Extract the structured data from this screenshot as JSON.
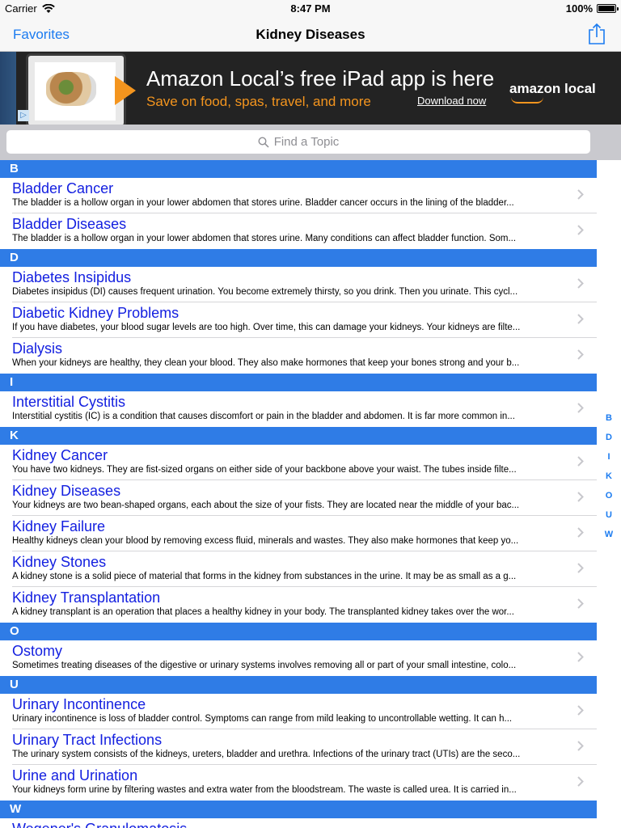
{
  "status": {
    "carrier": "Carrier",
    "time": "8:47 PM",
    "battery": "100%"
  },
  "nav": {
    "back_label": "Favorites",
    "title": "Kidney Diseases"
  },
  "ad": {
    "headline": "Amazon Local’s free iPad app is here",
    "subline": "Save on food, spas, travel, and more",
    "cta": "Download now",
    "logo": "amazon local"
  },
  "search": {
    "placeholder": "Find a Topic"
  },
  "sections": [
    {
      "letter": "B",
      "items": [
        {
          "title": "Bladder Cancer",
          "desc": "The bladder is a hollow organ in your lower abdomen that stores urine. Bladder cancer occurs in the lining of the bladder..."
        },
        {
          "title": "Bladder Diseases",
          "desc": "The bladder is a hollow organ in your lower abdomen that stores urine. Many conditions can affect bladder function. Som..."
        }
      ]
    },
    {
      "letter": "D",
      "items": [
        {
          "title": "Diabetes Insipidus",
          "desc": "Diabetes insipidus (DI) causes frequent urination. You become extremely thirsty, so you drink. Then you urinate. This cycl..."
        },
        {
          "title": "Diabetic Kidney Problems",
          "desc": "If you have diabetes, your blood sugar levels are too high. Over time, this can damage your kidneys. Your kidneys are filte..."
        },
        {
          "title": "Dialysis",
          "desc": "When your kidneys are healthy, they clean your blood. They also make hormones that keep your bones strong and your b..."
        }
      ]
    },
    {
      "letter": "I",
      "items": [
        {
          "title": "Interstitial Cystitis",
          "desc": "Interstitial cystitis (IC) is a condition that causes discomfort or pain in the bladder and abdomen. It is far more common in..."
        }
      ]
    },
    {
      "letter": "K",
      "items": [
        {
          "title": "Kidney Cancer",
          "desc": "You have two kidneys. They are fist-sized organs on either side of your backbone above your waist. The tubes inside filte..."
        },
        {
          "title": "Kidney Diseases",
          "desc": "Your kidneys are two bean-shaped organs, each about the size of your fists. They are located near the middle of your bac..."
        },
        {
          "title": "Kidney Failure",
          "desc": "Healthy kidneys clean your blood by removing excess fluid, minerals and wastes. They also make hormones that keep yo..."
        },
        {
          "title": "Kidney Stones",
          "desc": "A kidney stone is a solid piece of material that forms in the kidney from substances in the urine. It may be as small as a g..."
        },
        {
          "title": "Kidney Transplantation",
          "desc": "A kidney transplant is an operation that places a healthy kidney in your body. The transplanted kidney takes over the wor..."
        }
      ]
    },
    {
      "letter": "O",
      "items": [
        {
          "title": "Ostomy",
          "desc": "Sometimes treating diseases of the digestive or urinary systems involves removing all or part of your small intestine, colo..."
        }
      ]
    },
    {
      "letter": "U",
      "items": [
        {
          "title": "Urinary Incontinence",
          "desc": "Urinary incontinence is loss of bladder control. Symptoms can range from mild leaking to uncontrollable wetting. It can h..."
        },
        {
          "title": "Urinary Tract Infections",
          "desc": "The urinary system consists of the kidneys, ureters, bladder and urethra. Infections of the urinary tract (UTIs) are the seco..."
        },
        {
          "title": "Urine and Urination",
          "desc": "Your kidneys form urine by filtering wastes and extra water from the bloodstream. The waste is called urea. It is carried in..."
        }
      ]
    },
    {
      "letter": "W",
      "items": [
        {
          "title": "Wegener's Granulomatosis",
          "desc": ""
        }
      ]
    }
  ],
  "index_letters": [
    "B",
    "D",
    "I",
    "K",
    "O",
    "U",
    "W"
  ]
}
